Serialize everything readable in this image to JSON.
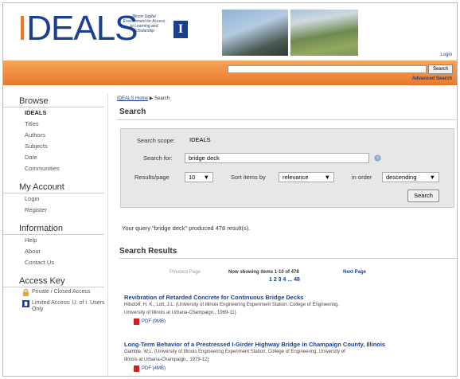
{
  "header": {
    "logo_a": "I",
    "logo_b": "DEALS",
    "tagline": "Illinois Digital Environment for Access to Learning and Scholarship",
    "i_mark": "I",
    "login": "Login",
    "search_btn": "Search",
    "advanced": "Advanced Search"
  },
  "sidebar": {
    "browse_title": "Browse",
    "browse": [
      "IDEALS",
      "Titles",
      "Authors",
      "Subjects",
      "Date",
      "Communities"
    ],
    "account_title": "My Account",
    "account": [
      "Login",
      "Register"
    ],
    "info_title": "Information",
    "info": [
      "Help",
      "About",
      "Contact Us"
    ],
    "key_title": "Access Key",
    "key": [
      {
        "label": "Private / Closed Access",
        "icon": "lock-icon"
      },
      {
        "label": "Limited Access: U. of I. Users Only",
        "icon": "university-i-icon"
      }
    ]
  },
  "breadcrumb": {
    "home": "IDEALS Home",
    "sep": "▶",
    "current": "Search"
  },
  "page_title": "Search",
  "form": {
    "scope_label": "Search scope:",
    "scope_value": "IDEALS",
    "for_label": "Search for:",
    "for_value": "bridge deck",
    "rpp_label": "Results/page",
    "rpp_value": "10",
    "sort_label": "Sort items by",
    "sort_value": "relevance",
    "order_label": "in order",
    "order_value": "descending",
    "search_btn": "Search",
    "help_icon": "help-icon"
  },
  "query_text": "Your query \"bridge deck\" produced 478 result(s).",
  "results_title": "Search Results",
  "pager": {
    "prev": "Previous Page",
    "showing": "Now showing items 1-10 of 478",
    "next": "Next Page",
    "pages": "1 2 3 4 ... 48"
  },
  "results": [
    {
      "title": "Revibration of Retarded Concrete for Continuous Bridge Decks",
      "meta1": "Hilsdorf, H. K.; Lott, J.L. (University of Illinois Engineering Experiment Station. College of Engineering.",
      "meta2": "University of Illinois at Urbana-Champaign., 1969-11)",
      "pdf": "PDF (9MB)"
    },
    {
      "title": "Long-Term Behavior of a Prestressed I-Girder Highway Bridge in Champaign County, Illinois",
      "meta1": "Gamble, W.L. (University of Illinois Engineering Experiment Station. College of Engineering. University of",
      "meta2": "Illinois at Urbana-Champaign., 1979-12)",
      "pdf": "PDF (4MB)"
    }
  ]
}
